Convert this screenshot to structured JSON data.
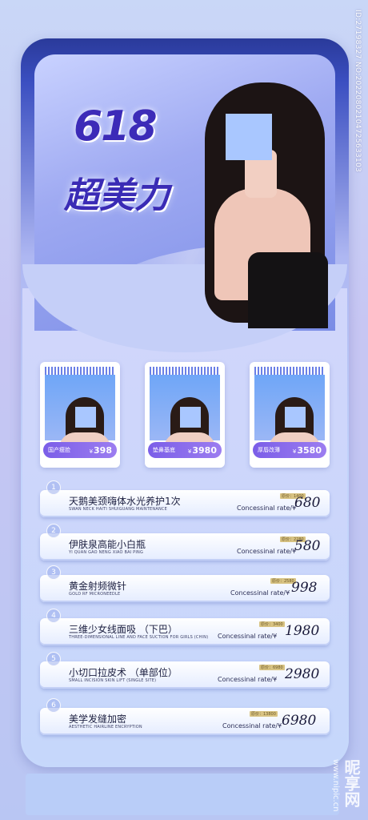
{
  "side_id": "ID:27198327 NO:20220802104725633103",
  "watermark": {
    "brand": "昵享网",
    "site": "www.nipic.cn"
  },
  "hero": {
    "logo_618": "618",
    "logo_text": "超美力"
  },
  "thumbnails": [
    {
      "name": "国产瘦脸",
      "price": "398",
      "currency": "¥"
    },
    {
      "name": "垫鼻基底",
      "price": "3980",
      "currency": "¥"
    },
    {
      "name": "厚唇改薄",
      "price": "3580",
      "currency": "¥"
    }
  ],
  "list": [
    {
      "num": "1",
      "title_cn": "天鹅美颈嗨体水光养护1次",
      "title_en": "SWAN NECK HAITI SHUIGUANG MAINTENANCE",
      "orig": "原价：1400",
      "rate_label": "Concessinal rate/¥",
      "price": "680"
    },
    {
      "num": "2",
      "title_cn": "伊肤泉高能小白瓶",
      "title_en": "YI QUAN GAO NENG XIAO BAI PING",
      "orig": "原价：2280",
      "rate_label": "Concessinal rate/¥",
      "price": "580"
    },
    {
      "num": "3",
      "title_cn": "黄金射频微针",
      "title_en": "GOLD RF MICRONEEDLE",
      "orig": "原价：2580",
      "rate_label": "Concessinal rate/¥",
      "price": "998"
    },
    {
      "num": "4",
      "title_cn": "三维少女线面吸 （下巴）",
      "title_en": "THREE-DIMENSIONAL LINE AND FACE SUCTION FOR GIRLS (CHIN)",
      "orig": "原价：3400",
      "rate_label": "Concessinal rate/¥",
      "price": "1980"
    },
    {
      "num": "5",
      "title_cn": "小切口拉皮术 （单部位）",
      "title_en": "SMALL INCISION SKIN LIFT (SINGLE SITE)",
      "orig": "原价：6980",
      "rate_label": "Concessinal rate/¥",
      "price": "2980"
    },
    {
      "num": "6",
      "title_cn": "美学发缝加密",
      "title_en": "AESTHETIC HAIRLINE ENCRYPTION",
      "orig": "原价：13800",
      "rate_label": "Concessinal rate/¥",
      "price": "6980"
    }
  ],
  "colors": {
    "accent": "#3a2bb5",
    "tag_purple": "#7b5ee8",
    "background": "#c9d7f7"
  }
}
